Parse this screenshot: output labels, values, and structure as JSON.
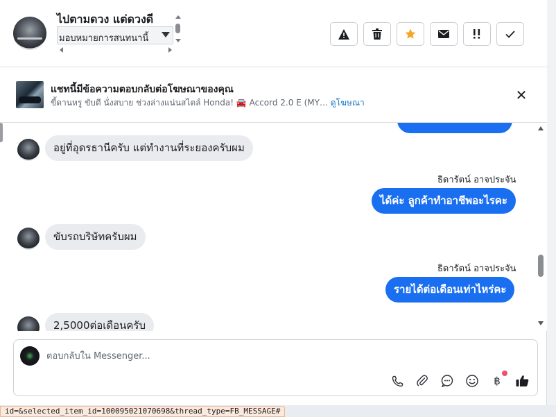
{
  "header": {
    "contact_name": "ไปตามดวง แต่ดวงดี",
    "label_select_value": "มอบหมายการสนทนานี้",
    "actions": [
      {
        "name": "report-spam",
        "icon": "warning-icon"
      },
      {
        "name": "delete",
        "icon": "trash-icon"
      },
      {
        "name": "star",
        "icon": "star-icon"
      },
      {
        "name": "mark-unread",
        "icon": "envelope-icon"
      },
      {
        "name": "follow-up",
        "icon": "exclamation-icon"
      },
      {
        "name": "mark-done",
        "icon": "check-icon"
      }
    ]
  },
  "ad_bar": {
    "title": "แชทนี้มีข้อความตอบกลับต่อโฆษณาของคุณ",
    "description": "ขี้ดานหรู ขับดี นั่งสบาย ช่วงล่างแน่นสไตล์ Honda! 🚘 Accord 2.0 E (MY…",
    "link_label": "ดูโฆษณา",
    "close_icon": "close-icon"
  },
  "messages": [
    {
      "direction": "in",
      "text": "อยู่ที่อุดรธานีครับ   แต่ทำงานที่ระยองครับผม"
    },
    {
      "direction": "out",
      "sender": "ธิดารัตน์ อาจประจัน",
      "text": "ได้ค่ะ ลูกค้าทำอาชีพอะไรคะ"
    },
    {
      "direction": "in",
      "text": "ขับรถบริษัทครับผม"
    },
    {
      "direction": "out",
      "sender": "ธิดารัตน์ อาจประจัน",
      "text": "รายได้ต่อเดือนเท่าไหร่คะ"
    },
    {
      "direction": "in",
      "text": "2,5000ต่อเดือนครับ"
    }
  ],
  "composer": {
    "placeholder": "ตอบกลับใน Messenger...",
    "tools": [
      "phone-icon",
      "paperclip-icon",
      "chat-bubble-icon",
      "emoji-icon",
      "baht-icon",
      "thumbs-up-icon"
    ]
  },
  "status_bar": {
    "url_text": "id=&selected_item_id=100095021070698&thread_type=FB_MESSAGE#"
  },
  "colors": {
    "outgoing_bubble": "#1a6ff0",
    "incoming_bubble": "#e9ebee",
    "star": "#f5a623",
    "link": "#1877c4"
  }
}
